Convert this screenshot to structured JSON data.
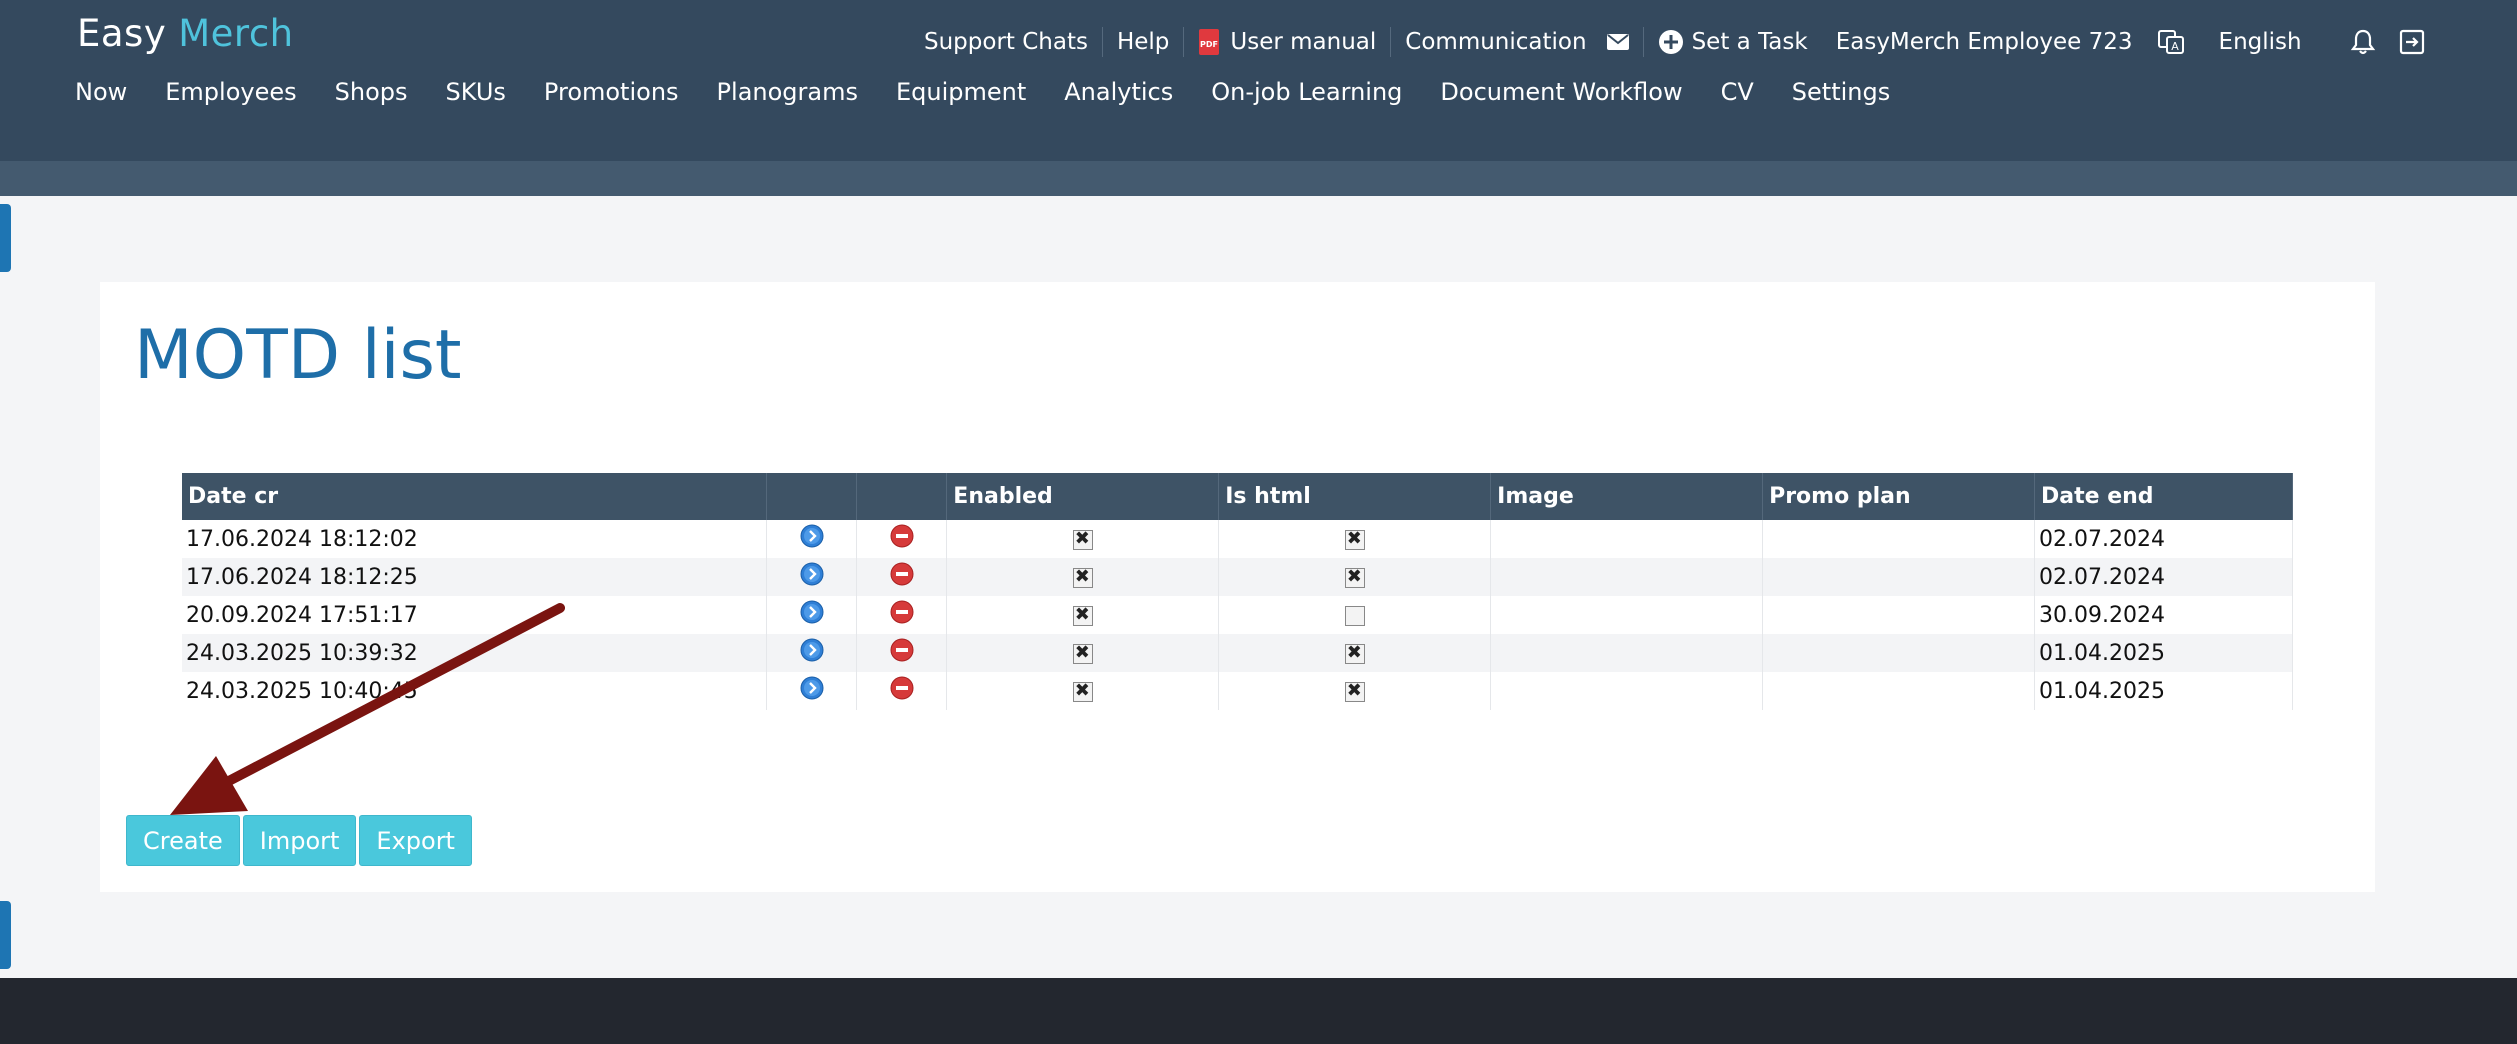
{
  "app": {
    "logo_part1": "Easy",
    "logo_part2": "Merch"
  },
  "topnav": {
    "support_chats": "Support Chats",
    "help": "Help",
    "user_manual": "User manual",
    "communication": "Communication",
    "set_task": "Set a Task",
    "user_name": "EasyMerch Employee 723",
    "language": "English"
  },
  "mainnav": [
    "Now",
    "Employees",
    "Shops",
    "SKUs",
    "Promotions",
    "Planograms",
    "Equipment",
    "Analytics",
    "On-job Learning",
    "Document Workflow",
    "CV",
    "Settings"
  ],
  "page": {
    "title": "MOTD list"
  },
  "table": {
    "headers": [
      "Date cr",
      "",
      "",
      "Enabled",
      "Is html",
      "Image",
      "Promo plan",
      "Date end"
    ],
    "rows": [
      {
        "date_cr": "17.06.2024 18:12:02",
        "enabled": true,
        "is_html": true,
        "image": "",
        "promo_plan": "",
        "date_end": "02.07.2024"
      },
      {
        "date_cr": "17.06.2024 18:12:25",
        "enabled": true,
        "is_html": true,
        "image": "",
        "promo_plan": "",
        "date_end": "02.07.2024"
      },
      {
        "date_cr": "20.09.2024 17:51:17",
        "enabled": true,
        "is_html": false,
        "image": "",
        "promo_plan": "",
        "date_end": "30.09.2024"
      },
      {
        "date_cr": "24.03.2025 10:39:32",
        "enabled": true,
        "is_html": true,
        "image": "",
        "promo_plan": "",
        "date_end": "01.04.2025"
      },
      {
        "date_cr": "24.03.2025 10:40:45",
        "enabled": true,
        "is_html": true,
        "image": "",
        "promo_plan": "",
        "date_end": "01.04.2025"
      }
    ]
  },
  "buttons": {
    "create": "Create",
    "import": "Import",
    "export": "Export"
  },
  "colors": {
    "header": "#34495e",
    "accent": "#4ac8dc",
    "title": "#1e6ea8",
    "annotation_arrow": "#7a1410"
  }
}
